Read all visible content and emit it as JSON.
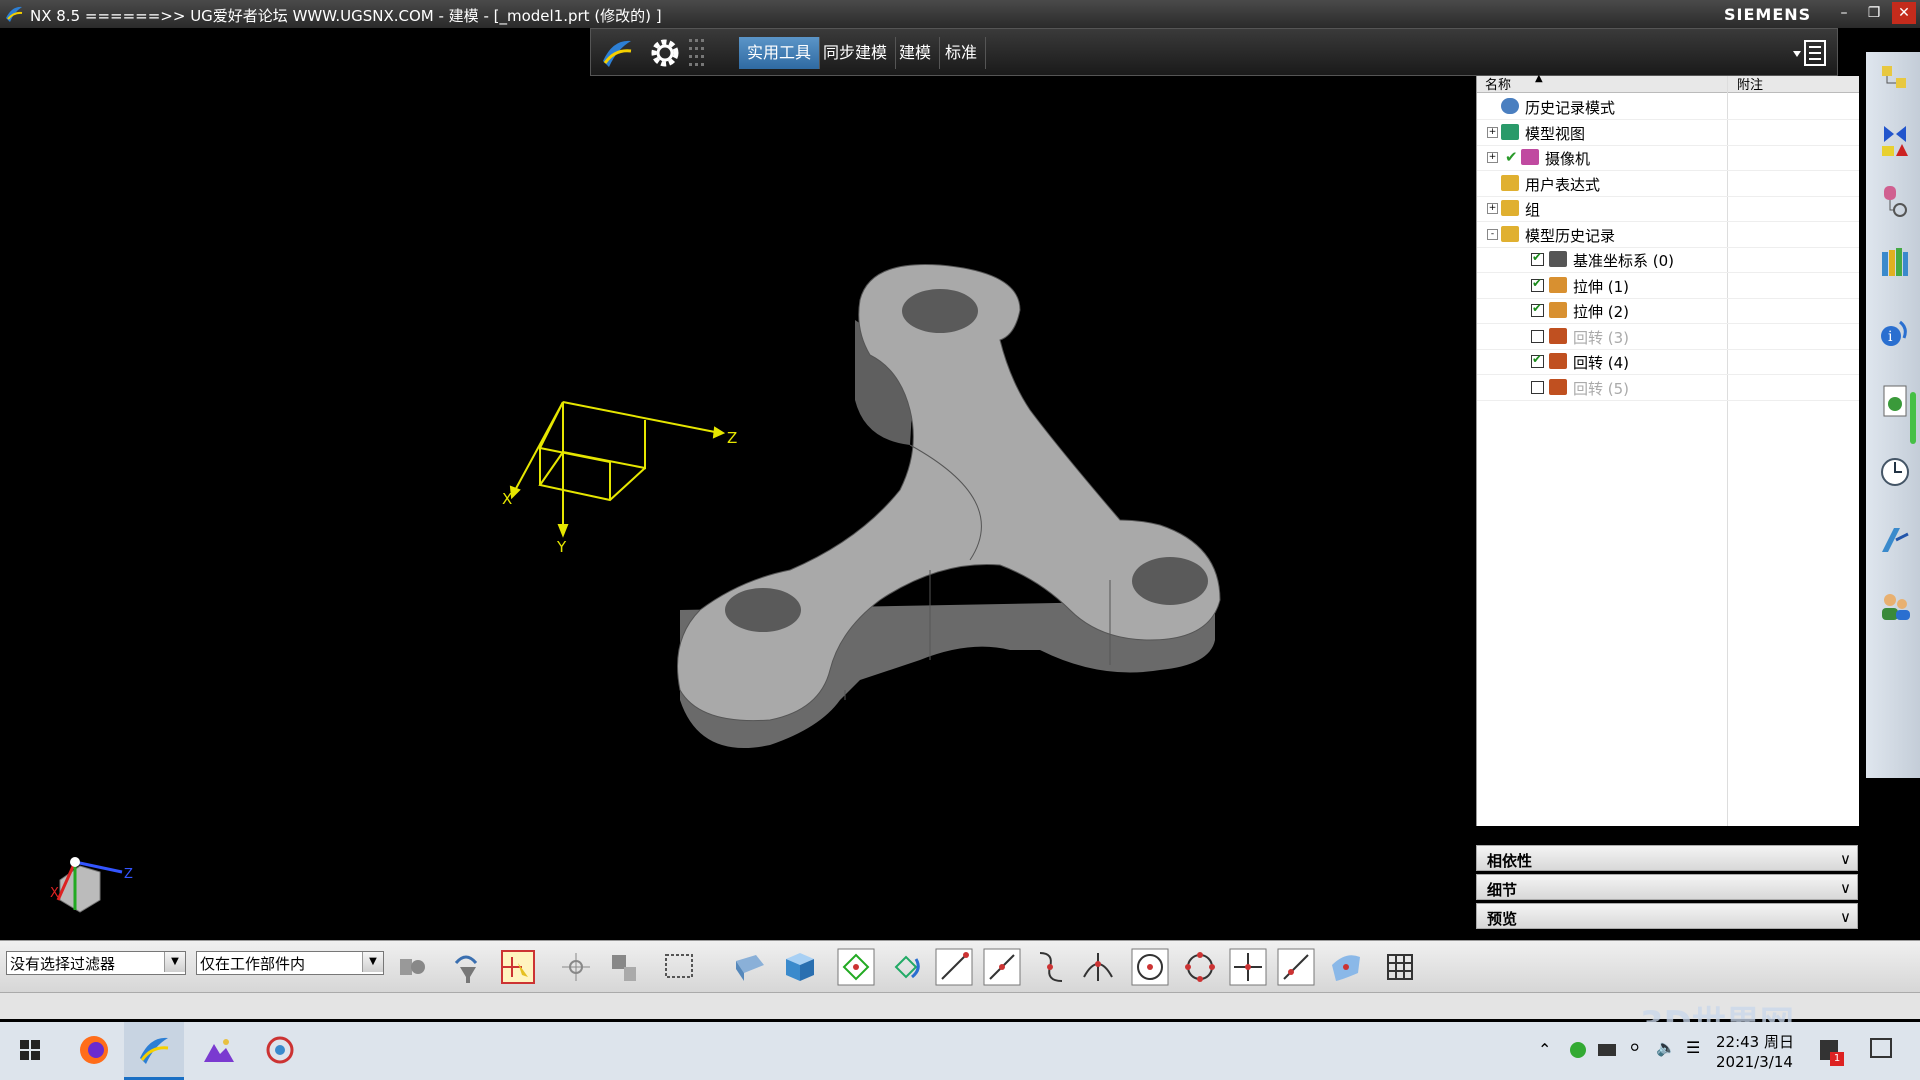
{
  "window": {
    "title": "NX 8.5  ======>>  UG爱好者论坛  WWW.UGSNX.COM - 建模 - [_model1.prt  (修改的) ]",
    "brand": "SIEMENS"
  },
  "ribbon": {
    "tabs": [
      "实用工具",
      "同步建模",
      "建模",
      "标准"
    ],
    "active_tab": "实用工具"
  },
  "navigator": {
    "col_name": "名称",
    "col_note": "附注",
    "rows": [
      {
        "label": "历史记录模式",
        "icon": "clock-icon",
        "indent": 0,
        "state": ""
      },
      {
        "label": "模型视图",
        "icon": "model-view-icon",
        "indent": 0,
        "state": "expandable"
      },
      {
        "label": "摄像机",
        "icon": "camera-icon",
        "indent": 0,
        "state": "expandable-checked"
      },
      {
        "label": "用户表达式",
        "icon": "folder-icon",
        "indent": 0,
        "state": ""
      },
      {
        "label": "组",
        "icon": "folder-icon",
        "indent": 0,
        "state": "expandable"
      },
      {
        "label": "模型历史记录",
        "icon": "folder-open-icon",
        "indent": 0,
        "state": "expanded"
      },
      {
        "label": "基准坐标系 (0)",
        "icon": "datum-csys-icon",
        "indent": 1,
        "checked": true,
        "dim": false
      },
      {
        "label": "拉伸 (1)",
        "icon": "extrude-icon",
        "indent": 1,
        "checked": true,
        "dim": false
      },
      {
        "label": "拉伸 (2)",
        "icon": "extrude-icon",
        "indent": 1,
        "checked": true,
        "dim": false
      },
      {
        "label": "回转 (3)",
        "icon": "revolve-icon",
        "indent": 1,
        "checked": false,
        "dim": true
      },
      {
        "label": "回转 (4)",
        "icon": "revolve-icon",
        "indent": 1,
        "checked": true,
        "dim": false
      },
      {
        "label": "回转 (5)",
        "icon": "revolve-icon",
        "indent": 1,
        "checked": false,
        "dim": true
      }
    ],
    "panels": [
      "相依性",
      "细节",
      "预览"
    ]
  },
  "viewport": {
    "csys_labels": {
      "x": "X",
      "y": "Y",
      "z": "Z"
    },
    "triad_labels": {
      "x": "X",
      "z": "Z"
    }
  },
  "toolbar": {
    "filter_value": "没有选择过滤器",
    "scope_value": "仅在工作部件内"
  },
  "taskbar": {
    "time": "22:43 周日",
    "date": "2021/3/14",
    "notification_count": "1"
  },
  "watermark": "3D世界网",
  "colors": {
    "viewport_bg": "#000000",
    "csys_yellow": "#e6e600",
    "active_tab": "#3a7ab5",
    "part_gray": "#a8a8a8"
  }
}
